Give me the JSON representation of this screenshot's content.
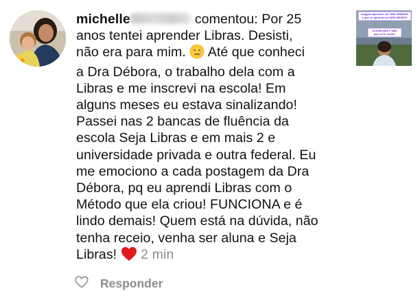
{
  "comment": {
    "username": "michelle",
    "action": "comentou:",
    "line1_rest": " Por 25",
    "body_before_emoji": "anos tentei aprender Libras. Desisti,\nnão era para mim. ",
    "body_after_emoji": " Até que conheci\na Dra Débora, o trabalho dela com a\nLibras e me inscrevi na escola! Em\nalguns meses eu estava sinalizando!\nPassei nas 2 bancas de fluência da\nescola Seja Libras e em mais 2 e\nuniversidade privada e outra federal. Eu\nme emociono a cada postagem da Dra\nDébora, pq eu aprendi Libras com o\nMétodo que ela criou! FUNCIONA e é\nlindo demais! Quem está na dúvida, não\ntenha receio, venha ser aluna e Seja\nLibras! ",
    "timestamp": "2 min",
    "emojis": {
      "crying": "crying-face-icon",
      "heart": "red-heart-icon"
    }
  },
  "post_thumbnail": {
    "banner_top": "Imagine aprender em UMA SEMANA o que eu aprendi em SEIS MESES?",
    "banner_middle": "Arrasta para o lado que eu te conto!"
  },
  "actions": {
    "like_icon": "heart-outline-icon",
    "reply_label": "Responder"
  },
  "colors": {
    "text": "#111111",
    "muted": "#8e8e8e",
    "heart": "#e0191f",
    "banner_text": "#6a2bd9"
  }
}
